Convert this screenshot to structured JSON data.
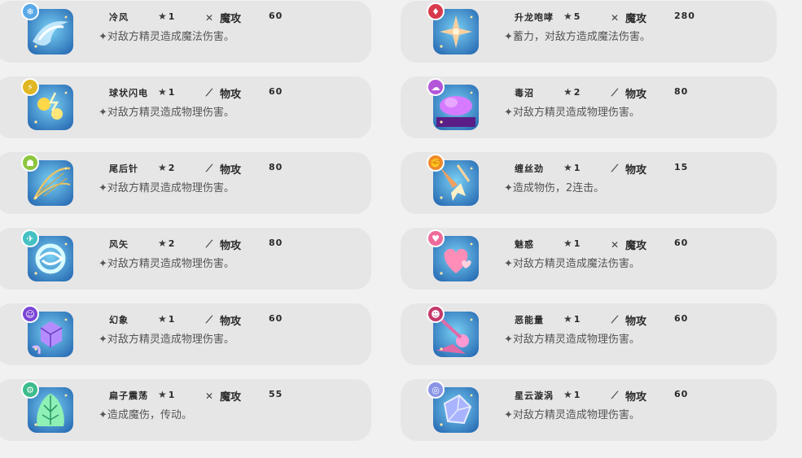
{
  "skills": [
    {
      "name": "冷风",
      "cost": "1",
      "category": "魔攻",
      "category_icon": "wand-icon",
      "power": "60",
      "desc": "✦对敌方精灵造成魔法伤害。",
      "badge": "❄",
      "badge_color": "#5aa8e6",
      "theme": "ice",
      "bg1": "#2b6fb6",
      "bg2": "#7ad0f4"
    },
    {
      "name": "升龙咆哮",
      "cost": "5",
      "category": "魔攻",
      "category_icon": "wand-icon",
      "power": "280",
      "desc": "✦蓄力，对敌方造成魔法伤害。",
      "badge": "♦",
      "badge_color": "#d83a4c",
      "theme": "dragon",
      "bg1": "#7a1f23",
      "bg2": "#c9483d"
    },
    {
      "name": "球状闪电",
      "cost": "1",
      "category": "物攻",
      "category_icon": "sword-icon",
      "power": "60",
      "desc": "✦对敌方精灵造成物理伤害。",
      "badge": "⚡",
      "badge_color": "#e0b622",
      "theme": "electric",
      "bg1": "#6a4a0c",
      "bg2": "#d6a420"
    },
    {
      "name": "毒沼",
      "cost": "2",
      "category": "物攻",
      "category_icon": "sword-icon",
      "power": "80",
      "desc": "✦对敌方精灵造成物理伤害。",
      "badge": "☁",
      "badge_color": "#b456d8",
      "theme": "poison",
      "bg1": "#4a1a6e",
      "bg2": "#b44ee0"
    },
    {
      "name": "尾后针",
      "cost": "2",
      "category": "物攻",
      "category_icon": "sword-icon",
      "power": "80",
      "desc": "✦对敌方精灵造成物理伤害。",
      "badge": "☗",
      "badge_color": "#8cc63f",
      "theme": "bug",
      "bg1": "#2f3b1c",
      "bg2": "#4e6028"
    },
    {
      "name": "缠丝劲",
      "cost": "1",
      "category": "物攻",
      "category_icon": "sword-icon",
      "power": "15",
      "desc": "✦造成物伤，2连击。",
      "badge": "✊",
      "badge_color": "#f08a2a",
      "theme": "fight",
      "bg1": "#5a2a12",
      "bg2": "#a85a26"
    },
    {
      "name": "风矢",
      "cost": "2",
      "category": "物攻",
      "category_icon": "sword-icon",
      "power": "80",
      "desc": "✦对敌方精灵造成物理伤害。",
      "badge": "✈",
      "badge_color": "#45c1c4",
      "theme": "wind",
      "bg1": "#1e6f7a",
      "bg2": "#56c6cf"
    },
    {
      "name": "魅惑",
      "cost": "1",
      "category": "魔攻",
      "category_icon": "wand-icon",
      "power": "60",
      "desc": "✦对敌方精灵造成魔法伤害。",
      "badge": "♥",
      "badge_color": "#ee6a9a",
      "theme": "fairy",
      "bg1": "#d6457a",
      "bg2": "#f59ab9"
    },
    {
      "name": "幻象",
      "cost": "1",
      "category": "物攻",
      "category_icon": "sword-icon",
      "power": "60",
      "desc": "✦对敌方精灵造成物理伤害。",
      "badge": "☺",
      "badge_color": "#7b45d6",
      "theme": "ghost",
      "bg1": "#3a1a7a",
      "bg2": "#7a47d2"
    },
    {
      "name": "恶能量",
      "cost": "1",
      "category": "物攻",
      "category_icon": "sword-icon",
      "power": "60",
      "desc": "✦对敌方精灵造成物理伤害。",
      "badge": "☻",
      "badge_color": "#c4386a",
      "theme": "dark",
      "bg1": "#2c1030",
      "bg2": "#8a2a6a"
    },
    {
      "name": "扁子震荡",
      "cost": "1",
      "category": "魔攻",
      "category_icon": "wand-icon",
      "power": "55",
      "desc": "✦造成魔伤，传动。",
      "badge": "⚙",
      "badge_color": "#3cbc8c",
      "theme": "grass",
      "bg1": "#1f7a5a",
      "bg2": "#6bd49a"
    },
    {
      "name": "星云漩涡",
      "cost": "1",
      "category": "物攻",
      "category_icon": "sword-icon",
      "power": "60",
      "desc": "✦对敌方精灵造成物理伤害。",
      "badge": "◎",
      "badge_color": "#8a94e6",
      "theme": "cosmic",
      "bg1": "#27326e",
      "bg2": "#6c7ae0"
    }
  ]
}
